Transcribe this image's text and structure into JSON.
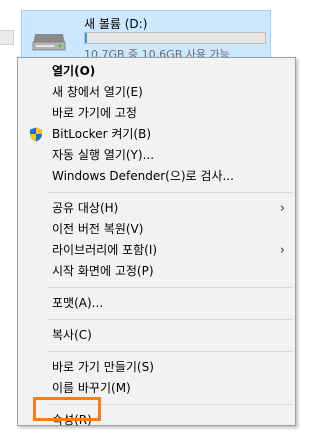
{
  "drive": {
    "name": "새 볼륨 (D:)",
    "size_text": "10.7GB 중 10.6GB 사용 가능",
    "used_fraction": 0.01,
    "bar_color": "#26a0da"
  },
  "menu": {
    "groups": [
      [
        {
          "label": "열기(O)",
          "bold": true
        },
        {
          "label": "새 창에서 열기(E)"
        },
        {
          "label": "바로 가기에 고정"
        },
        {
          "label": "BitLocker 켜기(B)",
          "icon": "shield-icon"
        },
        {
          "label": "자동 실행 열기(Y)..."
        },
        {
          "label": "Windows Defender(으)로 검사..."
        }
      ],
      [
        {
          "label": "공유 대상(H)",
          "submenu": true
        },
        {
          "label": "이전 버전 복원(V)"
        },
        {
          "label": "라이브러리에 포함(I)",
          "submenu": true
        },
        {
          "label": "시작 화면에 고정(P)"
        }
      ],
      [
        {
          "label": "포맷(A)..."
        }
      ],
      [
        {
          "label": "복사(C)"
        }
      ],
      [
        {
          "label": "바로 가기 만들기(S)"
        },
        {
          "label": "이름 바꾸기(M)"
        }
      ],
      [
        {
          "label": "속성(R)",
          "highlighted": true
        }
      ]
    ],
    "highlight_color": "#f07f1e"
  }
}
